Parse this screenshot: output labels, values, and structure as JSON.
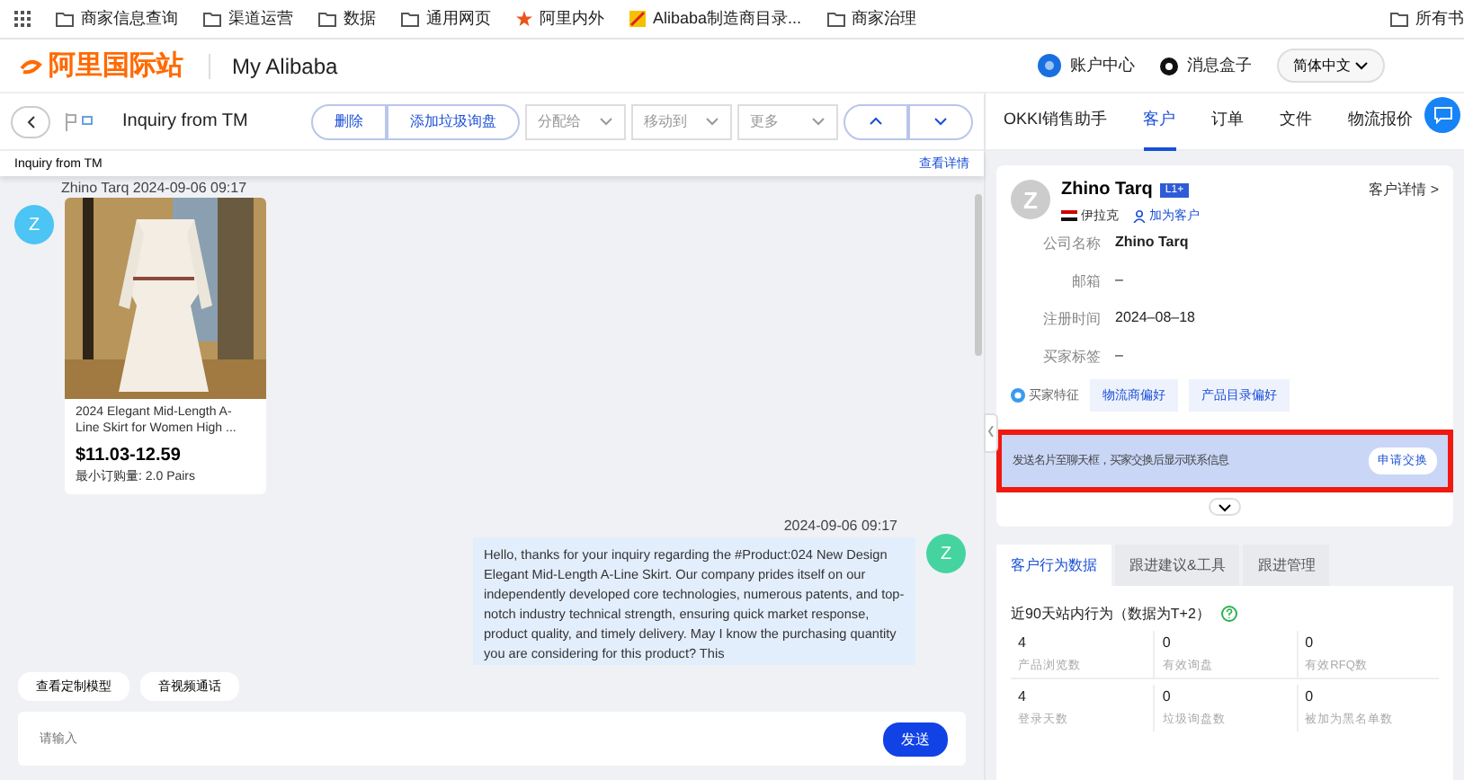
{
  "bookmarks": [
    {
      "label": "商家信息查询",
      "kind": "folder"
    },
    {
      "label": "渠道运营",
      "kind": "folder"
    },
    {
      "label": "数据",
      "kind": "folder"
    },
    {
      "label": "通用网页",
      "kind": "folder"
    },
    {
      "label": "阿里内外",
      "kind": "star"
    },
    {
      "label": "Alibaba制造商目录...",
      "kind": "site"
    },
    {
      "label": "商家治理",
      "kind": "folder"
    }
  ],
  "bookmarks_end": "所有书",
  "header": {
    "logo": "阿里国际站",
    "title": "My Alibaba",
    "account": "账户中心",
    "messages": "消息盒子",
    "language": "简体中文"
  },
  "toolbar": {
    "subject": "Inquiry from TM",
    "actions": [
      "删除",
      "添加垃圾询盘"
    ],
    "dropdowns": [
      "分配给",
      "移动到",
      "更多"
    ]
  },
  "subheader": {
    "subject": "Inquiry from TM",
    "link": "查看详情"
  },
  "chat": {
    "incoming": {
      "avatar": "Z",
      "meta": "Zhino Tarq   2024-09-06 09:17",
      "product": {
        "title": "2024 Elegant Mid-Length A-Line Skirt for Women High ...",
        "price": "$11.03-12.59",
        "moq": "最小订购量:  2.0 Pairs"
      }
    },
    "outgoing": {
      "avatar": "Z",
      "time": "2024-09-06 09:17",
      "text": "Hello, thanks for your inquiry regarding the #Product:024 New Design Elegant Mid-Length A-Line Skirt. Our company prides itself on our independently developed core technologies, numerous patents, and top-notch industry technical strength, ensuring quick market response, product quality, and timely delivery. May I know the purchasing quantity you are considering for this product? This"
    },
    "quick_actions": [
      "查看定制模型",
      "音视频通话"
    ],
    "input": {
      "placeholder": "请输入"
    },
    "send": "发送"
  },
  "panel": {
    "tabs": [
      {
        "label": "OKKI销售助手",
        "selected": false
      },
      {
        "label": "客户",
        "selected": true
      },
      {
        "label": "订单",
        "selected": false
      },
      {
        "label": "文件",
        "selected": false
      },
      {
        "label": "物流报价",
        "selected": false
      }
    ],
    "customer": {
      "avatar": "Z",
      "name": "Zhino Tarq",
      "level": "L1+",
      "country": "伊拉克",
      "add": "加为客户",
      "details": "客户详情 >",
      "fields": [
        {
          "label": "公司名称",
          "value": "Zhino Tarq"
        },
        {
          "label": "邮箱",
          "value": "–"
        },
        {
          "label": "注册时间",
          "value": "2024–08–18"
        },
        {
          "label": "买家标签",
          "value": "–"
        }
      ],
      "traits_label": "买家特征",
      "traits": [
        "物流商偏好",
        "产品目录偏好"
      ],
      "exchange": {
        "text": "发送名片至聊天框，买家交换后显示联系信息",
        "button": "申请交换",
        "highlighted": true
      }
    },
    "data_tabs": [
      {
        "label": "客户行为数据",
        "selected": true
      },
      {
        "label": "跟进建议&工具",
        "selected": false
      },
      {
        "label": "跟进管理",
        "selected": false
      }
    ],
    "stats_title": "近90天站内行为（数据为T+2）",
    "stats": [
      {
        "value": "4",
        "label": "产品浏览数"
      },
      {
        "value": "0",
        "label": "有效询盘"
      },
      {
        "value": "0",
        "label": "有效RFQ数"
      },
      {
        "value": "4",
        "label": "登录天数"
      },
      {
        "value": "0",
        "label": "垃圾询盘数"
      },
      {
        "value": "0",
        "label": "被加为黑名单数"
      }
    ]
  }
}
